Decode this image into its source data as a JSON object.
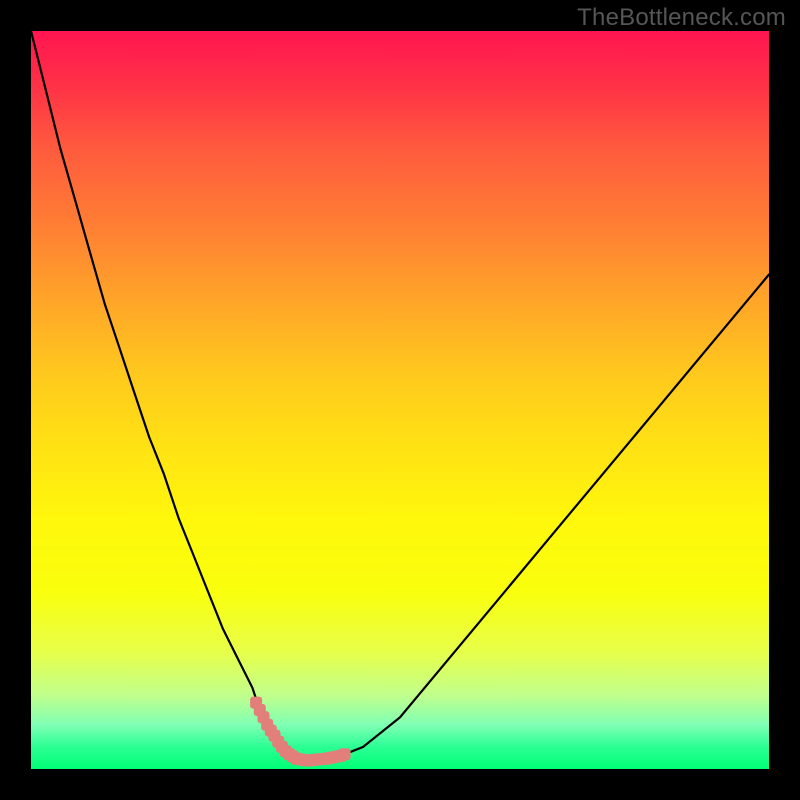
{
  "watermark": "TheBottleneck.com",
  "colors": {
    "frame": "#000000",
    "gradient_top": "#ff1550",
    "gradient_mid": "#fff70c",
    "gradient_bottom": "#00ff76",
    "curve": "#000000",
    "marker": "#e37f7a"
  },
  "chart_data": {
    "type": "line",
    "title": "",
    "xlabel": "",
    "ylabel": "",
    "xlim": [
      0,
      100
    ],
    "ylim": [
      0,
      100
    ],
    "series": [
      {
        "name": "bottleneck-curve",
        "x": [
          0,
          2,
          4,
          6,
          8,
          10,
          12,
          14,
          16,
          18,
          20,
          22,
          24,
          26,
          28,
          30,
          31,
          32,
          33,
          34,
          35,
          36,
          38,
          40,
          42,
          45,
          50,
          55,
          60,
          65,
          70,
          75,
          80,
          85,
          90,
          95,
          100
        ],
        "y": [
          100,
          92,
          84,
          77,
          70,
          63,
          57,
          51,
          45,
          40,
          34,
          29,
          24,
          19,
          15,
          11,
          8,
          6,
          4.5,
          3,
          2,
          1.4,
          1.2,
          1.4,
          1.8,
          3,
          7,
          13,
          19,
          25,
          31,
          37,
          43,
          49,
          55,
          61,
          67
        ]
      }
    ],
    "markers": {
      "name": "highlight-segment",
      "x": [
        30.5,
        31,
        31.5,
        32,
        32.5,
        33,
        33.5,
        34,
        34.5,
        35,
        35.5,
        36,
        36.5,
        37,
        37.5,
        38,
        38.5,
        39,
        39.5,
        40,
        40.5,
        41,
        41.5,
        42,
        42.5
      ],
      "y": [
        9,
        8,
        7,
        6,
        5.2,
        4.5,
        3.7,
        3,
        2.4,
        2,
        1.7,
        1.4,
        1.3,
        1.2,
        1.15,
        1.2,
        1.25,
        1.3,
        1.35,
        1.4,
        1.5,
        1.6,
        1.7,
        1.8,
        2
      ]
    }
  }
}
